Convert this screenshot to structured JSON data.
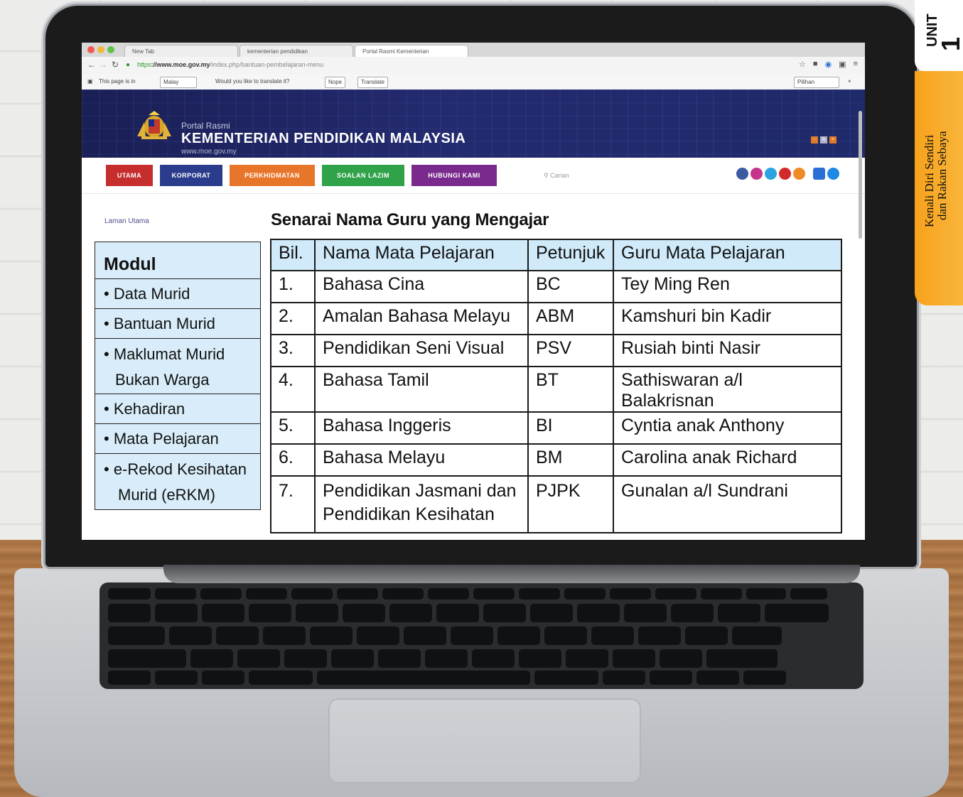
{
  "browser": {
    "tabs": [
      {
        "label": "New Tab"
      },
      {
        "label": "kementerian pendidikan"
      },
      {
        "label": "Portal Rasmi Kementerian"
      }
    ],
    "url_scheme": "https",
    "url_host": "://www.moe.gov.my",
    "url_path": "/index.php/bantuan-pembelajaran-menu",
    "translate_bar": {
      "prefix": "This page is in",
      "language": "Malay",
      "question": "Would you like to translate it?",
      "nope_label": "Nope",
      "translate_label": "Translate",
      "options_label": "Pilihan"
    }
  },
  "site": {
    "portal_label": "Portal Rasmi",
    "ministry_name": "KEMENTERIAN PENDIDIKAN MALAYSIA",
    "site_url": "www.moe.gov.my",
    "nav": [
      {
        "label": "UTAMA",
        "color": "#c62d2d"
      },
      {
        "label": "KORPORAT",
        "color": "#2c3c8c"
      },
      {
        "label": "PERKHIDMATAN",
        "color": "#e8762a"
      },
      {
        "label": "SOALAN LAZIM",
        "color": "#2fa24a"
      },
      {
        "label": "HUBUNGI KAMI",
        "color": "#7a2a8c"
      }
    ],
    "search_placeholder": "Carian",
    "breadcrumb": "Laman Utama"
  },
  "page_title": "Senarai Nama Guru yang Mengajar",
  "modul": {
    "title": "Modul",
    "items": [
      {
        "line1": "• Data Murid",
        "line2": ""
      },
      {
        "line1": "• Bantuan Murid",
        "line2": ""
      },
      {
        "line1": "• Maklumat Murid",
        "line2": "Bukan Warga"
      },
      {
        "line1": "• Kehadiran",
        "line2": ""
      },
      {
        "line1": "• Mata Pelajaran",
        "line2": ""
      },
      {
        "line1": "•  e-Rekod Kesihatan",
        "line2": "Murid (eRKM)"
      }
    ]
  },
  "table": {
    "headers": [
      "Bil.",
      "Nama Mata Pelajaran",
      "Petunjuk",
      "Guru Mata Pelajaran"
    ],
    "rows": [
      {
        "bil": "1.",
        "subject": "Bahasa Cina",
        "code": "BC",
        "teacher": "Tey Ming Ren"
      },
      {
        "bil": "2.",
        "subject": "Amalan Bahasa Melayu",
        "code": "ABM",
        "teacher": "Kamshuri bin Kadir"
      },
      {
        "bil": "3.",
        "subject": "Pendidikan Seni Visual",
        "code": "PSV",
        "teacher": "Rusiah binti Nasir"
      },
      {
        "bil": "4.",
        "subject": "Bahasa Tamil",
        "code": "BT",
        "teacher": "Sathiswaran a/l Balakrisnan"
      },
      {
        "bil": "5.",
        "subject": "Bahasa Inggeris",
        "code": "BI",
        "teacher": "Cyntia anak Anthony"
      },
      {
        "bil": "6.",
        "subject": "Bahasa Melayu",
        "code": "BM",
        "teacher": "Carolina anak Richard"
      },
      {
        "bil": "7.",
        "subject": "Pendidikan Jasmani dan",
        "subject_line2": "Pendidikan Kesihatan",
        "code": "PJPK",
        "teacher": "Gunalan a/l Sundrani"
      }
    ]
  },
  "unit_tab": {
    "word": "UNIT",
    "number": "1",
    "title_line1": "Kenali Diri Sendiri",
    "title_line2": "dan Rakan Sebaya"
  }
}
